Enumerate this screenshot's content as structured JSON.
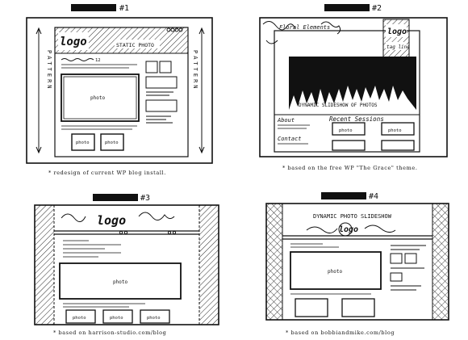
{
  "sketches": [
    {
      "number": "#1",
      "labels": {
        "logo": "logo",
        "header": "STATIC PHOTO",
        "photo": "photo",
        "thumb1": "photo",
        "thumb2": "photo",
        "pattern_left": "PATTERN",
        "pattern_right": "PATTERN"
      },
      "caption": "* redesign of current WP blog install."
    },
    {
      "number": "#2",
      "labels": {
        "floral": "Floral Elements",
        "logo": "logo",
        "tagline": "tag line",
        "slideshow": "DYNAMIC SLIDESHOW OF PHOTOS",
        "about": "About",
        "contact": "Contact",
        "recent": "Recent Sessions",
        "photo1": "photo",
        "photo2": "photo"
      },
      "caption": "* based on the free WP \"The Grace\" theme."
    },
    {
      "number": "#3",
      "labels": {
        "logo": "logo",
        "photo": "photo",
        "thumb1": "photo",
        "thumb2": "photo",
        "thumb3": "photo"
      },
      "caption": "* based on harrison-studio.com/blog"
    },
    {
      "number": "#4",
      "labels": {
        "title": "DYNAMIC PHOTO SLIDESHOW",
        "logo": "logo",
        "photo": "photo"
      },
      "caption": "* based on bobbiandmike.com/blog"
    }
  ],
  "colors": {
    "ink": "#111111",
    "paper": "#ffffff"
  }
}
